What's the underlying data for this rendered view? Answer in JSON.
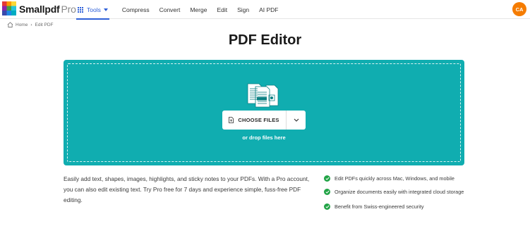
{
  "header": {
    "logo_text": "Smallpdf",
    "logo_suffix": "Pro",
    "nav": {
      "tools": "Tools",
      "compress": "Compress",
      "convert": "Convert",
      "merge": "Merge",
      "edit": "Edit",
      "sign": "Sign",
      "ai_pdf": "AI PDF"
    },
    "avatar_initials": "CA",
    "avatar_color": "#f57c00",
    "accent_color": "#2d5fd8"
  },
  "breadcrumb": {
    "home": "Home",
    "separator": "›",
    "current": "Edit PDF"
  },
  "page_title": "PDF Editor",
  "dropzone": {
    "background": "#10adb0",
    "choose_files": "CHOOSE FILES",
    "drop_hint": "or drop files here",
    "icons": [
      "files-illustration-icon",
      "file-upload-icon",
      "chevron-down-icon"
    ]
  },
  "description": "Easily add text, shapes, images, highlights, and sticky notes to your PDFs. With a Pro account, you can also edit existing text. Try Pro free for 7 days and experience simple, fuss-free PDF editing.",
  "features": [
    "Edit PDFs quickly across Mac, Windows, and mobile",
    "Organize documents easily with integrated cloud storage",
    "Benefit from Swiss-engineered security"
  ]
}
